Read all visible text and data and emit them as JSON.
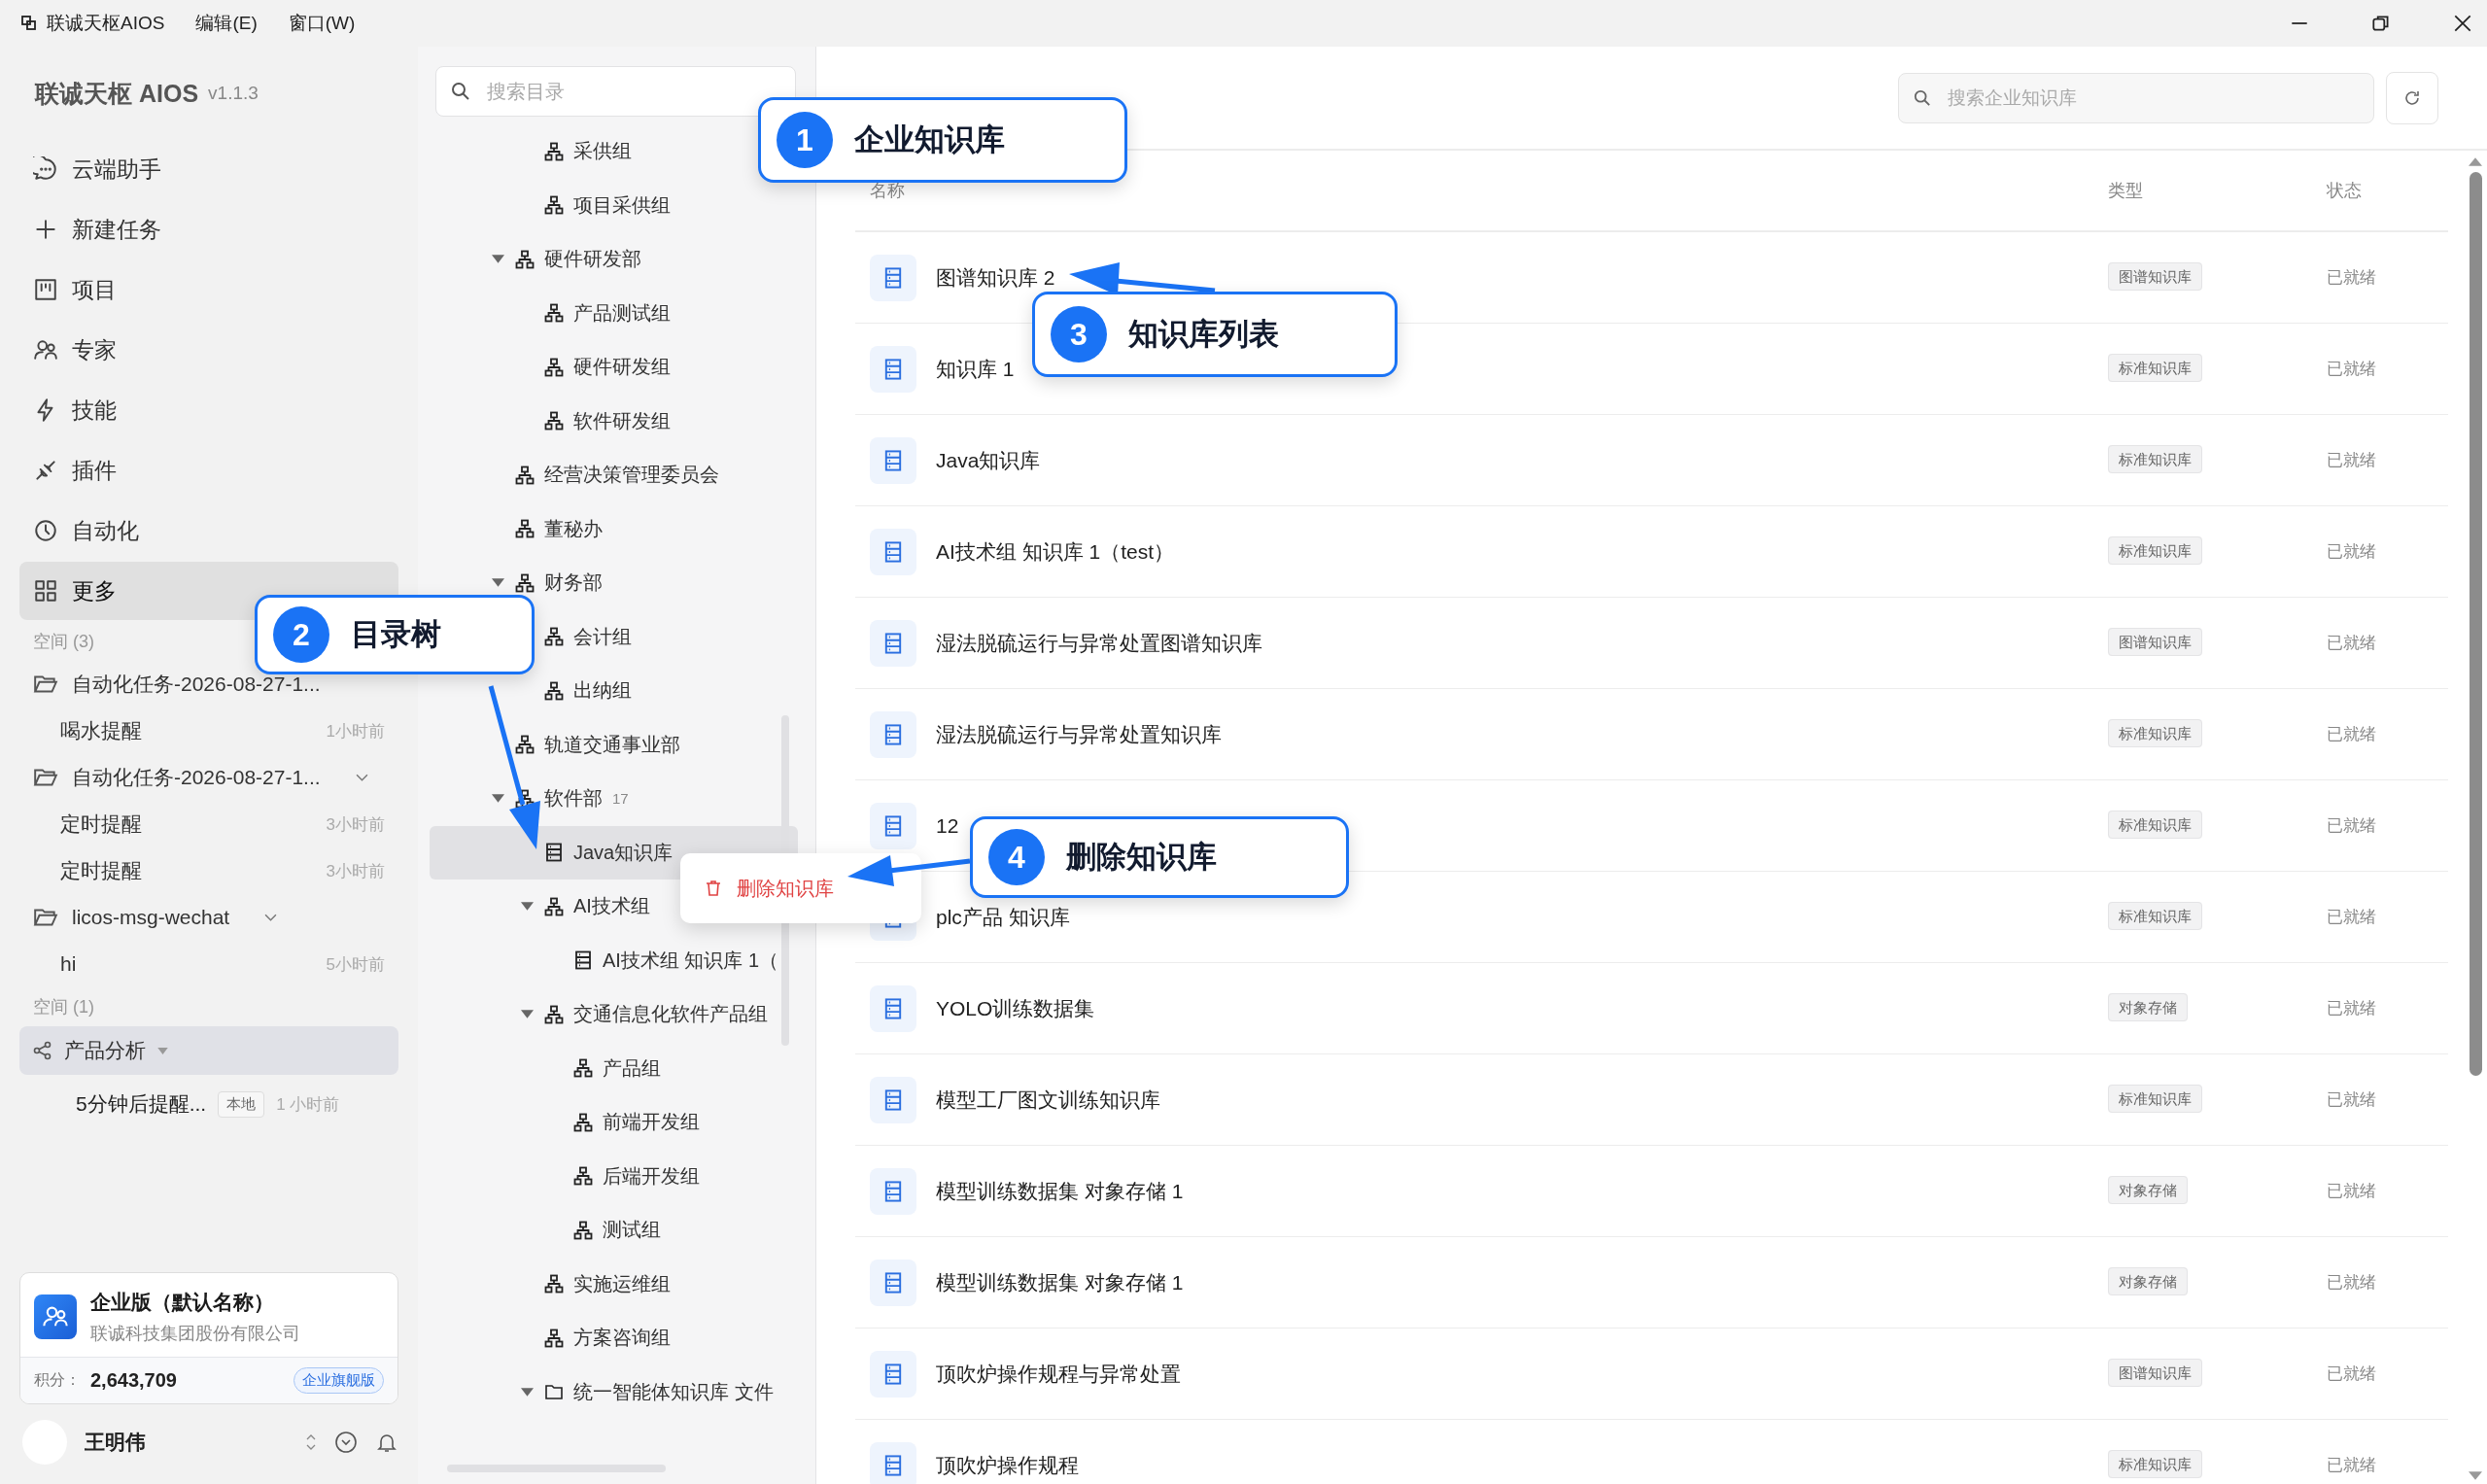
{
  "menu_bar": {
    "app_name": "联诚天枢AIOS",
    "menus": [
      "编辑(E)",
      "窗口(W)"
    ]
  },
  "sidebar": {
    "brand": "联诚天枢 AIOS",
    "version": "v1.1.3",
    "nav": [
      {
        "label": "云端助手",
        "kind": "chat",
        "selected": false
      },
      {
        "label": "新建任务",
        "kind": "plus",
        "selected": false
      },
      {
        "label": "项目",
        "kind": "board",
        "selected": false
      },
      {
        "label": "专家",
        "kind": "people",
        "selected": false
      },
      {
        "label": "技能",
        "kind": "bolt",
        "selected": false
      },
      {
        "label": "插件",
        "kind": "plug",
        "selected": false
      },
      {
        "label": "自动化",
        "kind": "clock",
        "selected": false
      },
      {
        "label": "更多",
        "kind": "grid",
        "selected": true
      }
    ],
    "space_groups": {
      "heading": "空间 (3)",
      "groups": [
        {
          "name": "自动化任务-2026-08-27-1...",
          "items": [
            {
              "name": "喝水提醒",
              "time": "1小时前"
            }
          ]
        },
        {
          "name": "自动化任务-2026-08-27-1...",
          "expanded": true,
          "items": [
            {
              "name": "定时提醒",
              "time": "3小时前"
            },
            {
              "name": "定时提醒",
              "time": "3小时前"
            }
          ]
        },
        {
          "name": "licos-msg-wechat",
          "expanded": true,
          "items": [
            {
              "name": "hi",
              "time": "5小时前"
            }
          ]
        }
      ]
    },
    "shared_space": {
      "heading": "空间 (1)",
      "project": {
        "name": "产品分析",
        "selected": true
      },
      "items": [
        {
          "name": "5分钟后提醒...",
          "tag": "本地",
          "time": "1 小时前"
        }
      ]
    },
    "org_card": {
      "title": "企业版（默认名称）",
      "company": "联诚科技集团股份有限公司",
      "points_label": "积分：",
      "points": "2,643,709",
      "plan": "企业旗舰版"
    },
    "user": {
      "name": "王明伟"
    }
  },
  "tree": {
    "search_placeholder": "搜索目录",
    "items": [
      {
        "children": [
          {
            "label": "采供组",
            "kind": "org",
            "selected": false
          },
          {
            "label": "项目采供组",
            "kind": "org",
            "selected": false
          }
        ]
      },
      {
        "label": "硬件研发部",
        "kind": "org",
        "expanded": true,
        "selected": false,
        "children": [
          {
            "label": "产品测试组",
            "kind": "org",
            "selected": false
          },
          {
            "label": "硬件研发组",
            "kind": "org",
            "selected": false
          },
          {
            "label": "软件研发组",
            "kind": "org",
            "selected": false
          }
        ]
      },
      {
        "label": "经营决策管理委员会",
        "kind": "org",
        "selected": false
      },
      {
        "label": "董秘办",
        "kind": "org",
        "selected": false
      },
      {
        "label": "财务部",
        "kind": "org",
        "expanded": true,
        "selected": false,
        "children": [
          {
            "label": "会计组",
            "kind": "org",
            "selected": false
          },
          {
            "label": "出纳组",
            "kind": "org",
            "selected": false
          }
        ]
      },
      {
        "label": "轨道交通事业部",
        "kind": "org",
        "selected": false
      },
      {
        "label": "软件部",
        "count": "17",
        "kind": "org",
        "expanded": true,
        "selected": false,
        "children": [
          {
            "label": "Java知识库",
            "kind": "kb",
            "selected": true
          },
          {
            "label": "AI技术组",
            "kind": "org",
            "expanded": true,
            "selected": false,
            "children": [
              {
                "label": "AI技术组 知识库 1（",
                "kind": "kb",
                "selected": false
              }
            ]
          },
          {
            "label": "交通信息化软件产品组",
            "kind": "org",
            "expanded": true,
            "selected": false,
            "children": [
              {
                "label": "产品组",
                "kind": "org",
                "selected": false
              },
              {
                "label": "前端开发组",
                "kind": "org",
                "selected": false
              },
              {
                "label": "后端开发组",
                "kind": "org",
                "selected": false
              },
              {
                "label": "测试组",
                "kind": "org",
                "selected": false
              }
            ]
          },
          {
            "label": "实施运维组",
            "kind": "org",
            "selected": false
          },
          {
            "label": "方案咨询组",
            "kind": "org",
            "selected": false
          },
          {
            "label": "统一智能体知识库 文件",
            "kind": "folder",
            "expanded": true,
            "selected": false
          }
        ]
      }
    ]
  },
  "context_menu": {
    "items": [
      {
        "label": "删除知识库",
        "kind": "danger"
      }
    ]
  },
  "knowledge_base": {
    "search_placeholder": "搜索企业知识库",
    "columns": [
      "名称",
      "类型",
      "状态"
    ],
    "rows": [
      {
        "name": "图谱知识库 2",
        "type": "图谱知识库",
        "status": "已就绪"
      },
      {
        "name": "知识库 1",
        "type": "标准知识库",
        "status": "已就绪"
      },
      {
        "name": "Java知识库",
        "type": "标准知识库",
        "status": "已就绪"
      },
      {
        "name": "AI技术组 知识库 1（test）",
        "type": "标准知识库",
        "status": "已就绪"
      },
      {
        "name": "湿法脱硫运行与异常处置图谱知识库",
        "type": "图谱知识库",
        "status": "已就绪"
      },
      {
        "name": "湿法脱硫运行与异常处置知识库",
        "type": "标准知识库",
        "status": "已就绪"
      },
      {
        "name": "12",
        "type": "标准知识库",
        "status": "已就绪"
      },
      {
        "name": "plc产品 知识库",
        "type": "标准知识库",
        "status": "已就绪"
      },
      {
        "name": "YOLO训练数据集",
        "type": "对象存储",
        "status": "已就绪"
      },
      {
        "name": "模型工厂图文训练知识库",
        "type": "标准知识库",
        "status": "已就绪"
      },
      {
        "name": "模型训练数据集 对象存储 1",
        "type": "对象存储",
        "status": "已就绪"
      },
      {
        "name": "模型训练数据集 对象存储 1",
        "type": "对象存储",
        "status": "已就绪"
      },
      {
        "name": "顶吹炉操作规程与异常处置",
        "type": "图谱知识库",
        "status": "已就绪"
      },
      {
        "name": "顶吹炉操作规程",
        "type": "标准知识库",
        "status": "已就绪"
      }
    ]
  },
  "annotations": [
    {
      "number": "1",
      "label": "企业知识库"
    },
    {
      "number": "2",
      "label": "目录树"
    },
    {
      "number": "3",
      "label": "知识库列表"
    },
    {
      "number": "4",
      "label": "删除知识库"
    }
  ]
}
